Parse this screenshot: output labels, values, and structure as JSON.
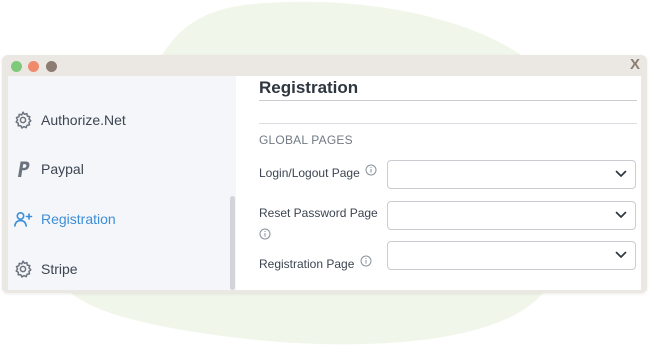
{
  "window": {
    "close_label": "X",
    "colors": {
      "dot_green": "#7ec97a",
      "dot_orange": "#ef8a6d",
      "dot_brown": "#8d7c72"
    }
  },
  "sidebar": {
    "items": [
      {
        "label": "Authorize.Net",
        "icon": "gear-icon",
        "active": false
      },
      {
        "label": "Paypal",
        "icon": "paypal-icon",
        "active": false
      },
      {
        "label": "Registration",
        "icon": "add-user-icon",
        "active": true
      },
      {
        "label": "Stripe",
        "icon": "gear-icon",
        "active": false
      }
    ]
  },
  "main": {
    "title": "Registration",
    "section_heading": "GLOBAL PAGES",
    "fields": [
      {
        "label": "Login/Logout Page",
        "value": ""
      },
      {
        "label": "Reset Password Page",
        "value": ""
      },
      {
        "label": "Registration Page",
        "value": ""
      }
    ]
  },
  "colors": {
    "accent": "#3b8ed8",
    "text": "#3c4551",
    "blob": "#f1f6ea"
  }
}
